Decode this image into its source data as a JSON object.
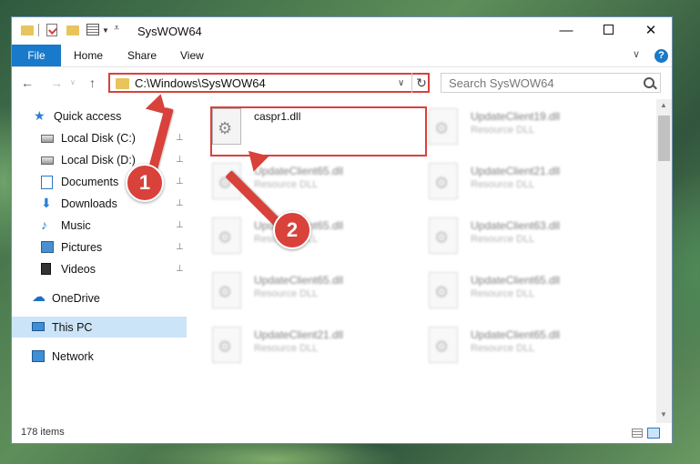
{
  "window": {
    "title": "SysWOW64",
    "controls": {
      "minimize": "—",
      "maximize": "",
      "close": "✕"
    }
  },
  "ribbon": {
    "tabs": [
      "File",
      "Home",
      "Share",
      "View"
    ],
    "chevron": "∨",
    "help": "?"
  },
  "address": {
    "path": "C:\\Windows\\SysWOW64",
    "refresh": "↻",
    "dropdown": "∨"
  },
  "search": {
    "placeholder": "Search SysWOW64"
  },
  "nav": {
    "back": "←",
    "forward": "→",
    "recent": "∨",
    "up": "↑",
    "items": [
      {
        "label": "Quick access",
        "icon": "star-icon"
      },
      {
        "label": "Local Disk (C:)",
        "icon": "drive-icon"
      },
      {
        "label": "Local Disk (D:)",
        "icon": "drive-icon"
      },
      {
        "label": "Documents",
        "icon": "documents-icon"
      },
      {
        "label": "Downloads",
        "icon": "downloads-icon"
      },
      {
        "label": "Music",
        "icon": "music-icon"
      },
      {
        "label": "Pictures",
        "icon": "pictures-icon"
      },
      {
        "label": "Videos",
        "icon": "videos-icon"
      },
      {
        "label": "OneDrive",
        "icon": "onedrive-icon"
      },
      {
        "label": "This PC",
        "icon": "computer-icon",
        "selected": true
      },
      {
        "label": "Network",
        "icon": "network-icon"
      }
    ],
    "pin": "📌"
  },
  "files": [
    {
      "name": "caspr1.dll",
      "type": ""
    },
    {
      "name": "UpdateClient19.dll",
      "type": "Resource DLL"
    },
    {
      "name": "UpdateClient65.dll",
      "type": "Resource DLL"
    },
    {
      "name": "UpdateClient21.dll",
      "type": "Resource DLL"
    },
    {
      "name": "UpdateClient65.dll",
      "type": "Resource DLL"
    },
    {
      "name": "UpdateClient63.dll",
      "type": "Resource DLL"
    },
    {
      "name": "UpdateClient65.dll",
      "type": "Resource DLL"
    },
    {
      "name": "UpdateClient65.dll",
      "type": "Resource DLL"
    },
    {
      "name": "UpdateClient21.dll",
      "type": "Resource DLL"
    },
    {
      "name": "UpdateClient65.dll",
      "type": "Resource DLL"
    }
  ],
  "status": {
    "item_count": "178 items"
  },
  "annotations": {
    "badge1": "1",
    "badge2": "2",
    "color": "#d9413b"
  }
}
